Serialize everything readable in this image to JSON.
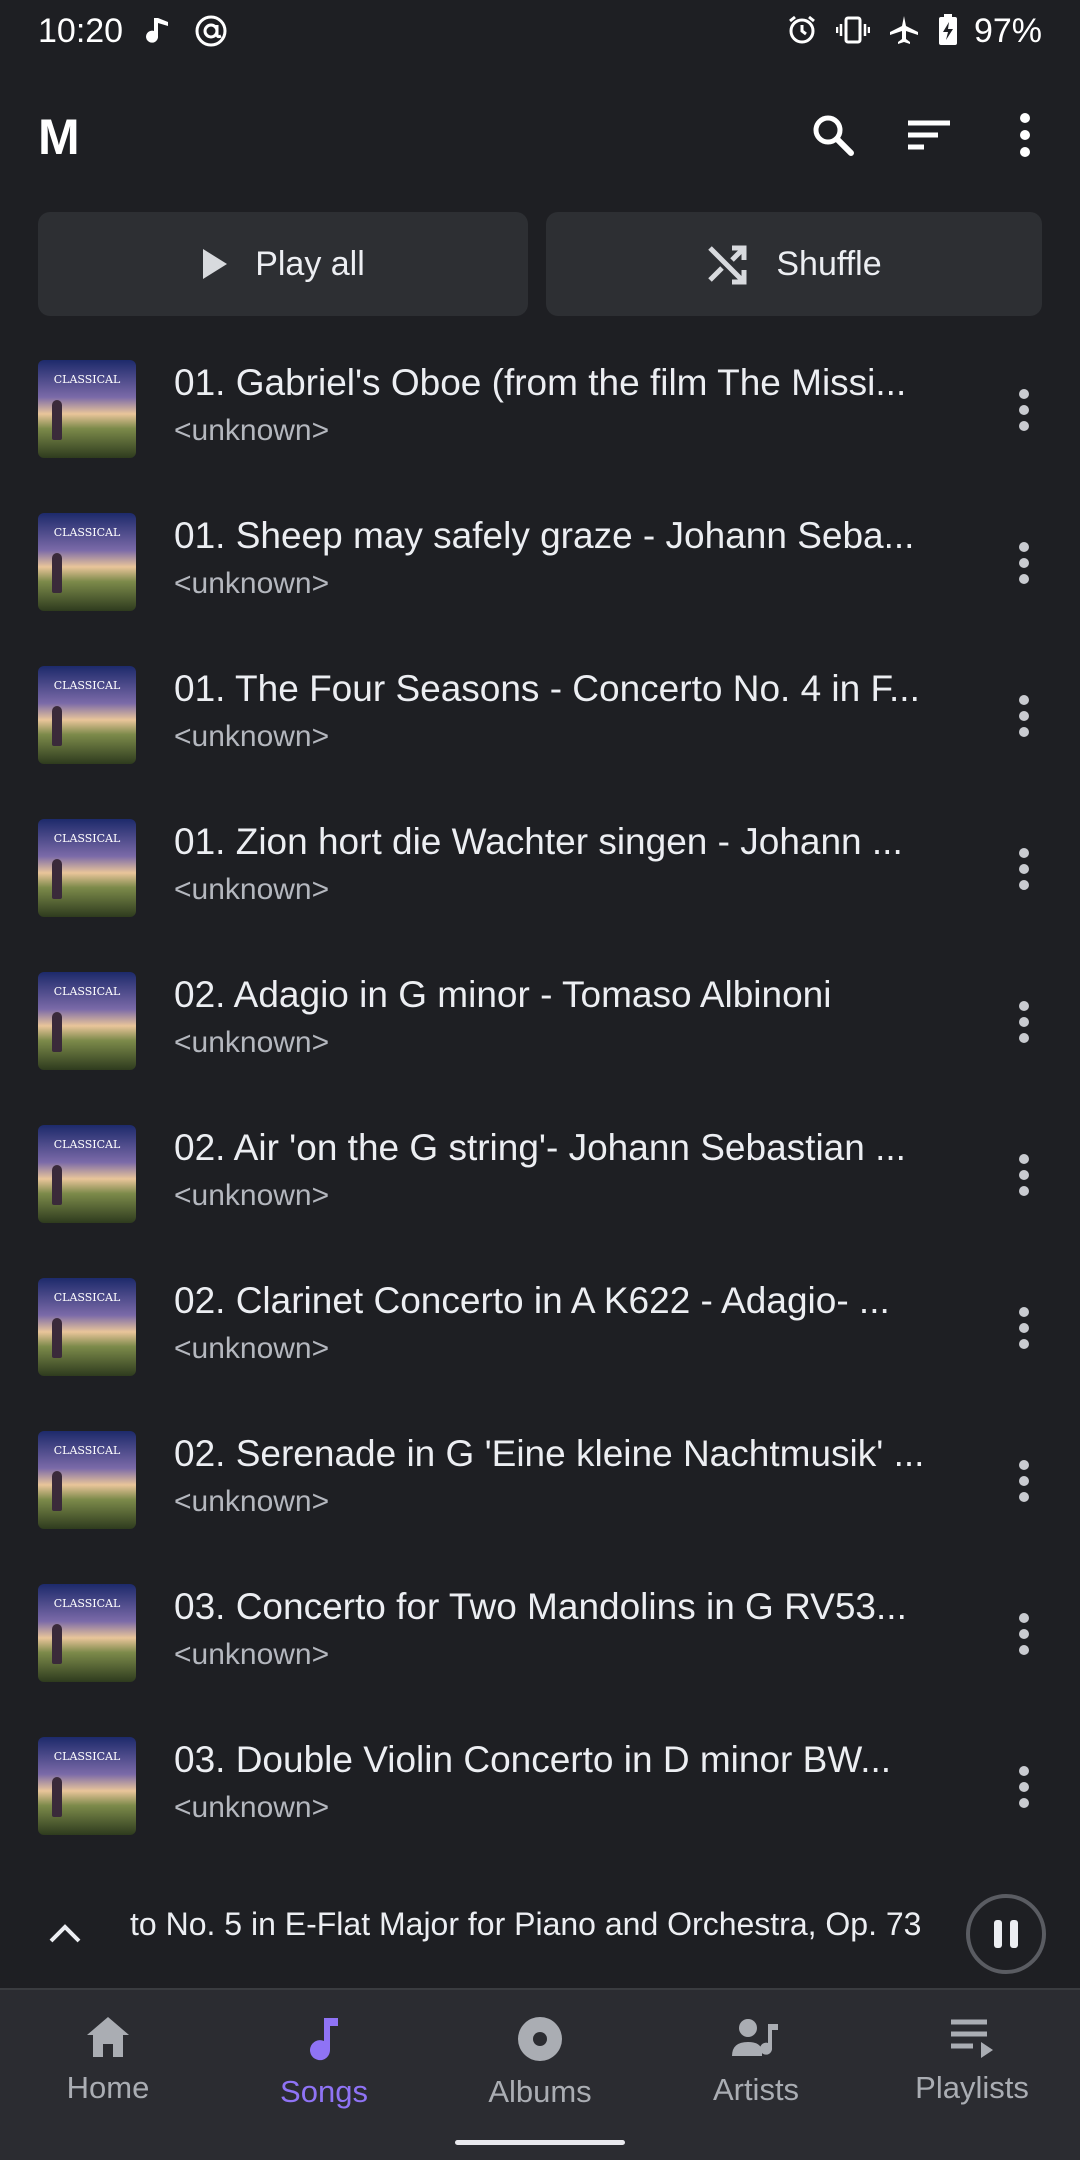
{
  "status_bar": {
    "time": "10:20",
    "battery": "97%",
    "left_icons": [
      "music-note-icon",
      "at-sign-icon"
    ],
    "right_icons": [
      "alarm-icon",
      "vibrate-icon",
      "airplane-icon",
      "battery-charging-icon"
    ]
  },
  "app_bar": {
    "logo": "M",
    "actions": [
      "search-icon",
      "sort-icon",
      "more-vert-icon"
    ]
  },
  "actions": {
    "play_all": "Play all",
    "shuffle": "Shuffle"
  },
  "songs": [
    {
      "title": "01. Gabriel's Oboe (from the film The Missi...",
      "artist": "<unknown>"
    },
    {
      "title": "01. Sheep may safely graze - Johann Seba...",
      "artist": "<unknown>"
    },
    {
      "title": "01. The Four Seasons - Concerto No. 4 in F...",
      "artist": "<unknown>"
    },
    {
      "title": "01. Zion hort die Wachter singen - Johann ...",
      "artist": "<unknown>"
    },
    {
      "title": "02. Adagio in G minor - Tomaso Albinoni",
      "artist": "<unknown>"
    },
    {
      "title": "02. Air 'on the G string'- Johann Sebastian ...",
      "artist": "<unknown>"
    },
    {
      "title": "02. Clarinet Concerto in A K622 - Adagio- ...",
      "artist": "<unknown>"
    },
    {
      "title": "02. Serenade in G 'Eine kleine Nachtmusik' ...",
      "artist": "<unknown>"
    },
    {
      "title": "03. Concerto for Two Mandolins in G RV53...",
      "artist": "<unknown>"
    },
    {
      "title": "03. Double Violin Concerto in D minor BW...",
      "artist": "<unknown>"
    }
  ],
  "album_art_text": "CLASSICAL",
  "mini_player": {
    "now_playing": "to No. 5 in E-Flat Major for Piano and Orchestra, Op. 73"
  },
  "nav": {
    "items": [
      {
        "label": "Home",
        "icon": "home-icon",
        "active": false
      },
      {
        "label": "Songs",
        "icon": "music-note-icon",
        "active": true
      },
      {
        "label": "Albums",
        "icon": "disc-icon",
        "active": false
      },
      {
        "label": "Artists",
        "icon": "artist-icon",
        "active": false
      },
      {
        "label": "Playlists",
        "icon": "playlist-icon",
        "active": false
      }
    ]
  },
  "colors": {
    "background": "#1e1f23",
    "accent": "#8f73f5",
    "button_bg": "#2d2f33",
    "nav_bg": "#2b2c31"
  }
}
